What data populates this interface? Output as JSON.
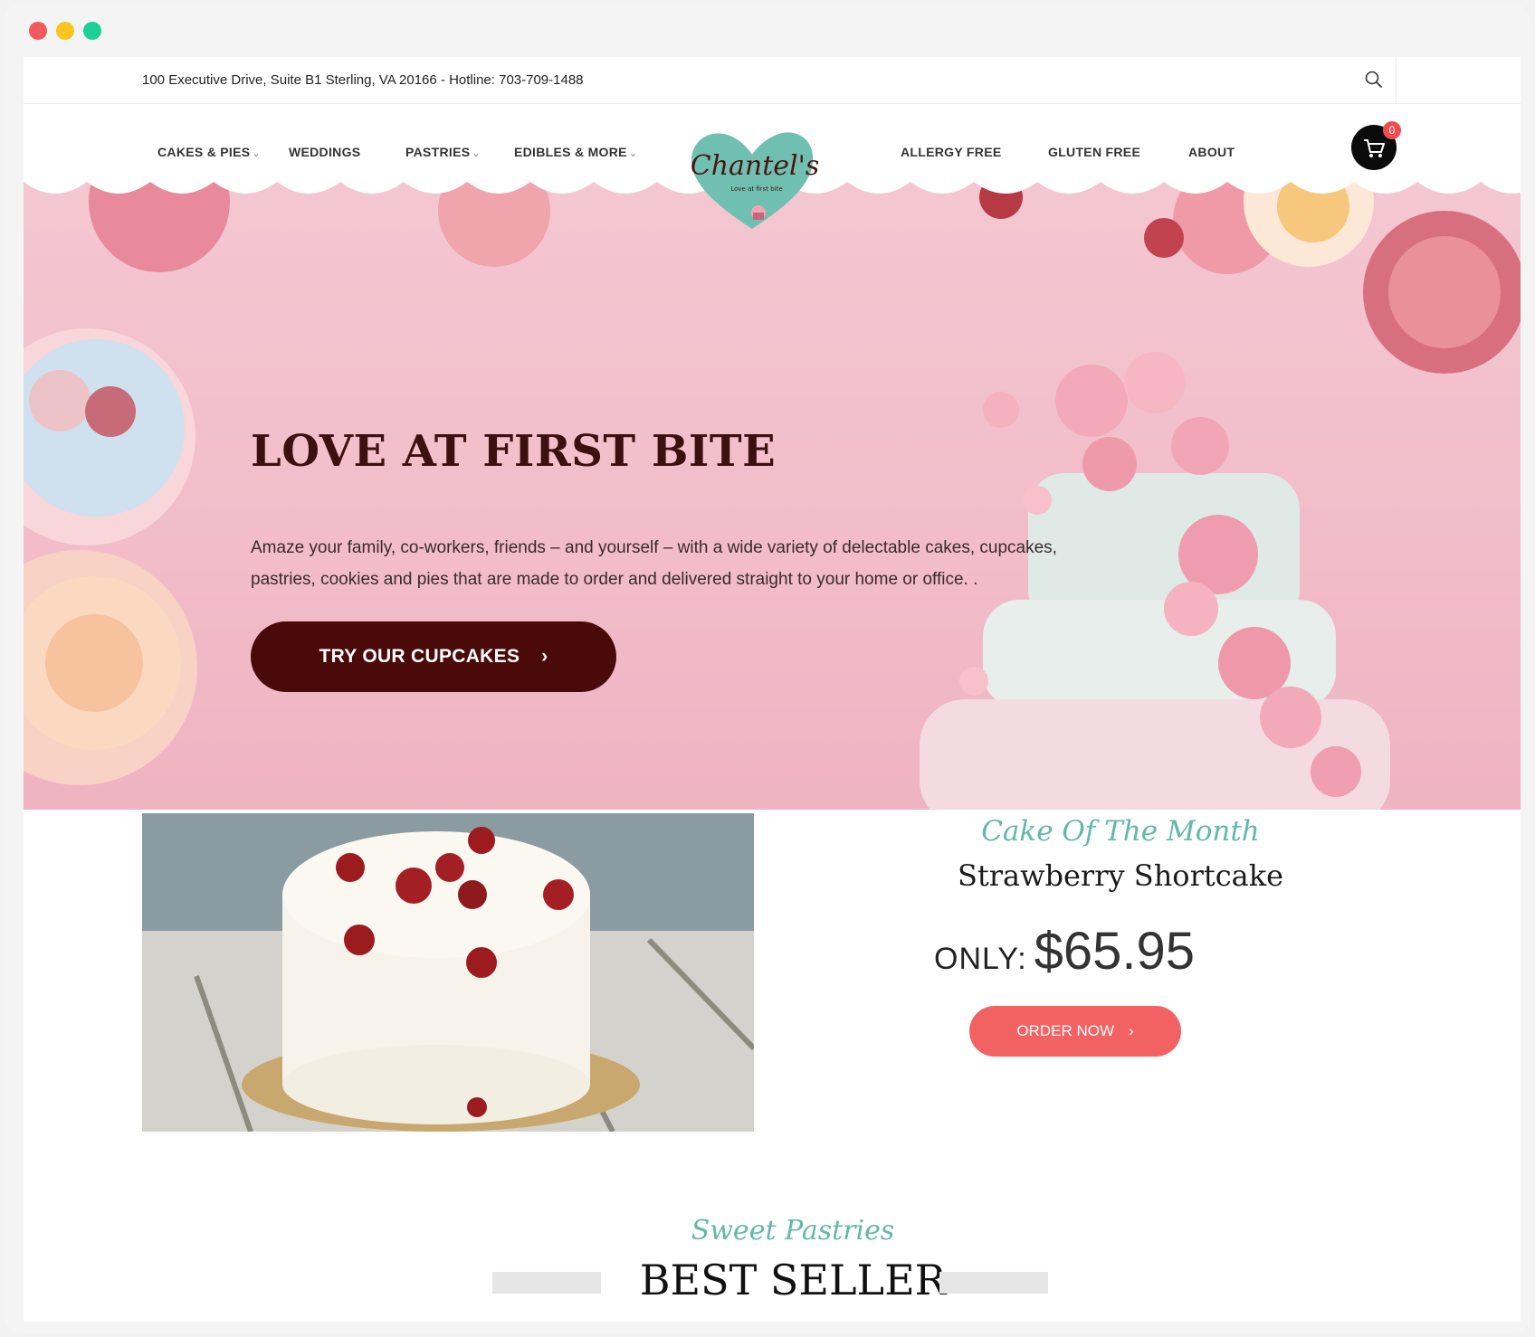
{
  "window": {
    "dots": [
      "#f25b5b",
      "#f8c521",
      "#1ccf97"
    ]
  },
  "topbar": {
    "address": "100 Executive Drive, Suite B1 Sterling, VA 20166 - Hotline: 703-709-1488"
  },
  "nav": {
    "left": [
      {
        "label": "CAKES & PIES",
        "dropdown": true
      },
      {
        "label": "WEDDINGS",
        "dropdown": false
      },
      {
        "label": "PASTRIES",
        "dropdown": true
      },
      {
        "label": "EDIBLES & MORE",
        "dropdown": true
      }
    ],
    "right": [
      {
        "label": "ALLERGY FREE"
      },
      {
        "label": "GLUTEN FREE"
      },
      {
        "label": "ABOUT"
      }
    ],
    "cart_count": "0",
    "logo_text": "Chantel's",
    "logo_tagline": "Love at first bite"
  },
  "hero": {
    "title": "LOVE AT FIRST BITE",
    "text": "Amaze your family, co-workers, friends – and yourself – with a wide variety of delectable cakes, cupcakes, pastries, cookies and pies that are made to order and delivered straight to your home or office. .",
    "cta_label": "TRY OUR CUPCAKES"
  },
  "cake_of_month": {
    "script": "Cake Of The Month",
    "name": "Strawberry Shortcake",
    "only_label": "ONLY:",
    "price": "$65.95",
    "order_label": "ORDER NOW"
  },
  "best_seller": {
    "script": "Sweet Pastries",
    "title": "BEST SELLER"
  },
  "colors": {
    "accent_teal": "#62b8a9",
    "cta_dark": "#4a0a0a",
    "order_red": "#f26262",
    "hero_pink": "#f2bcc9"
  },
  "icons": [
    "search-icon",
    "cart-icon",
    "chevron-right-icon",
    "chevron-down-icon"
  ]
}
